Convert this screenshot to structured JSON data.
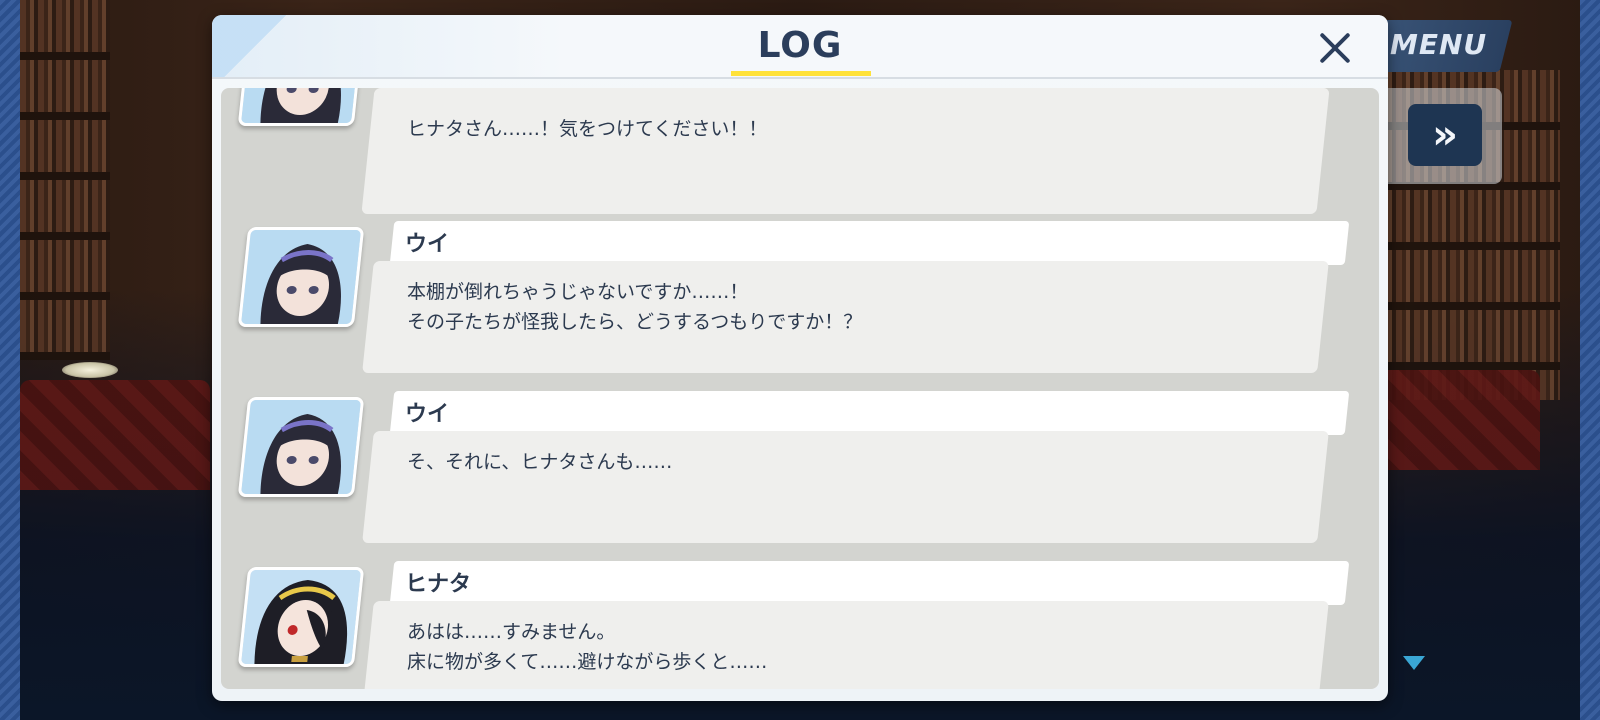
{
  "hud": {
    "menu_label": "MENU",
    "skip_label": "»",
    "auto_label": "]"
  },
  "log": {
    "title": "LOG",
    "close_icon": "close-icon",
    "accent_color": "#ffe23a",
    "entries": [
      {
        "speaker": "",
        "character": "ui",
        "lines": [
          "ヒナタさん……！気をつけてください！！"
        ]
      },
      {
        "speaker": "ウイ",
        "character": "ui",
        "lines": [
          "本棚が倒れちゃうじゃないですか……！",
          "その子たちが怪我したら、どうするつもりですか！？"
        ]
      },
      {
        "speaker": "ウイ",
        "character": "ui",
        "lines": [
          "そ、それに、ヒナタさんも……"
        ]
      },
      {
        "speaker": "ヒナタ",
        "character": "hinata",
        "lines": [
          "あはは……すみません。",
          "床に物が多くて……避けながら歩くと……"
        ]
      }
    ]
  }
}
